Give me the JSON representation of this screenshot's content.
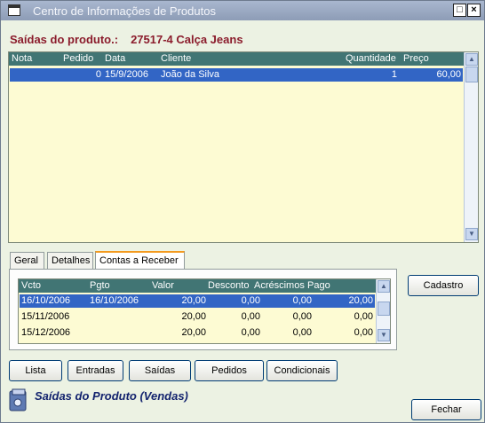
{
  "window": {
    "title": "Centro de Informações de Produtos"
  },
  "product": {
    "label": "Saídas do produto.:",
    "code_name": "27517-4 Calça Jeans"
  },
  "sales_grid": {
    "columns": [
      "Nota",
      "Pedido",
      "Data",
      "Cliente",
      "Quantidade",
      "Preço"
    ],
    "rows": [
      {
        "nota": "",
        "pedido": "0",
        "data": "15/9/2006",
        "cliente": "João da Silva",
        "quantidade": "1",
        "preco": "60,00"
      }
    ]
  },
  "tabs": [
    "Geral",
    "Detalhes",
    "Contas a Receber"
  ],
  "receivables_grid": {
    "columns": [
      "Vcto",
      "Pgto",
      "Valor",
      "Desconto",
      "Acréscimos",
      "Pago"
    ],
    "rows": [
      {
        "vcto": "16/10/2006",
        "pgto": "16/10/2006",
        "valor": "20,00",
        "desconto": "0,00",
        "acrescimos": "0,00",
        "pago": "20,00"
      },
      {
        "vcto": "15/11/2006",
        "pgto": "",
        "valor": "20,00",
        "desconto": "0,00",
        "acrescimos": "0,00",
        "pago": "0,00"
      },
      {
        "vcto": "15/12/2006",
        "pgto": "",
        "valor": "20,00",
        "desconto": "0,00",
        "acrescimos": "0,00",
        "pago": "0,00"
      }
    ]
  },
  "buttons": {
    "cadastro": "Cadastro",
    "lista": "Lista",
    "entradas": "Entradas",
    "saidas": "Saídas",
    "pedidos": "Pedidos",
    "condicionais": "Condicionais",
    "fechar": "Fechar"
  },
  "footer": {
    "title": "Saídas do Produto (Vendas)"
  },
  "colors": {
    "grid_header": "#417574",
    "selection": "#3265c5",
    "grid_bg": "#fdfbd3",
    "heading": "#8b1c2c",
    "tab_accent": "#f39a1f"
  }
}
